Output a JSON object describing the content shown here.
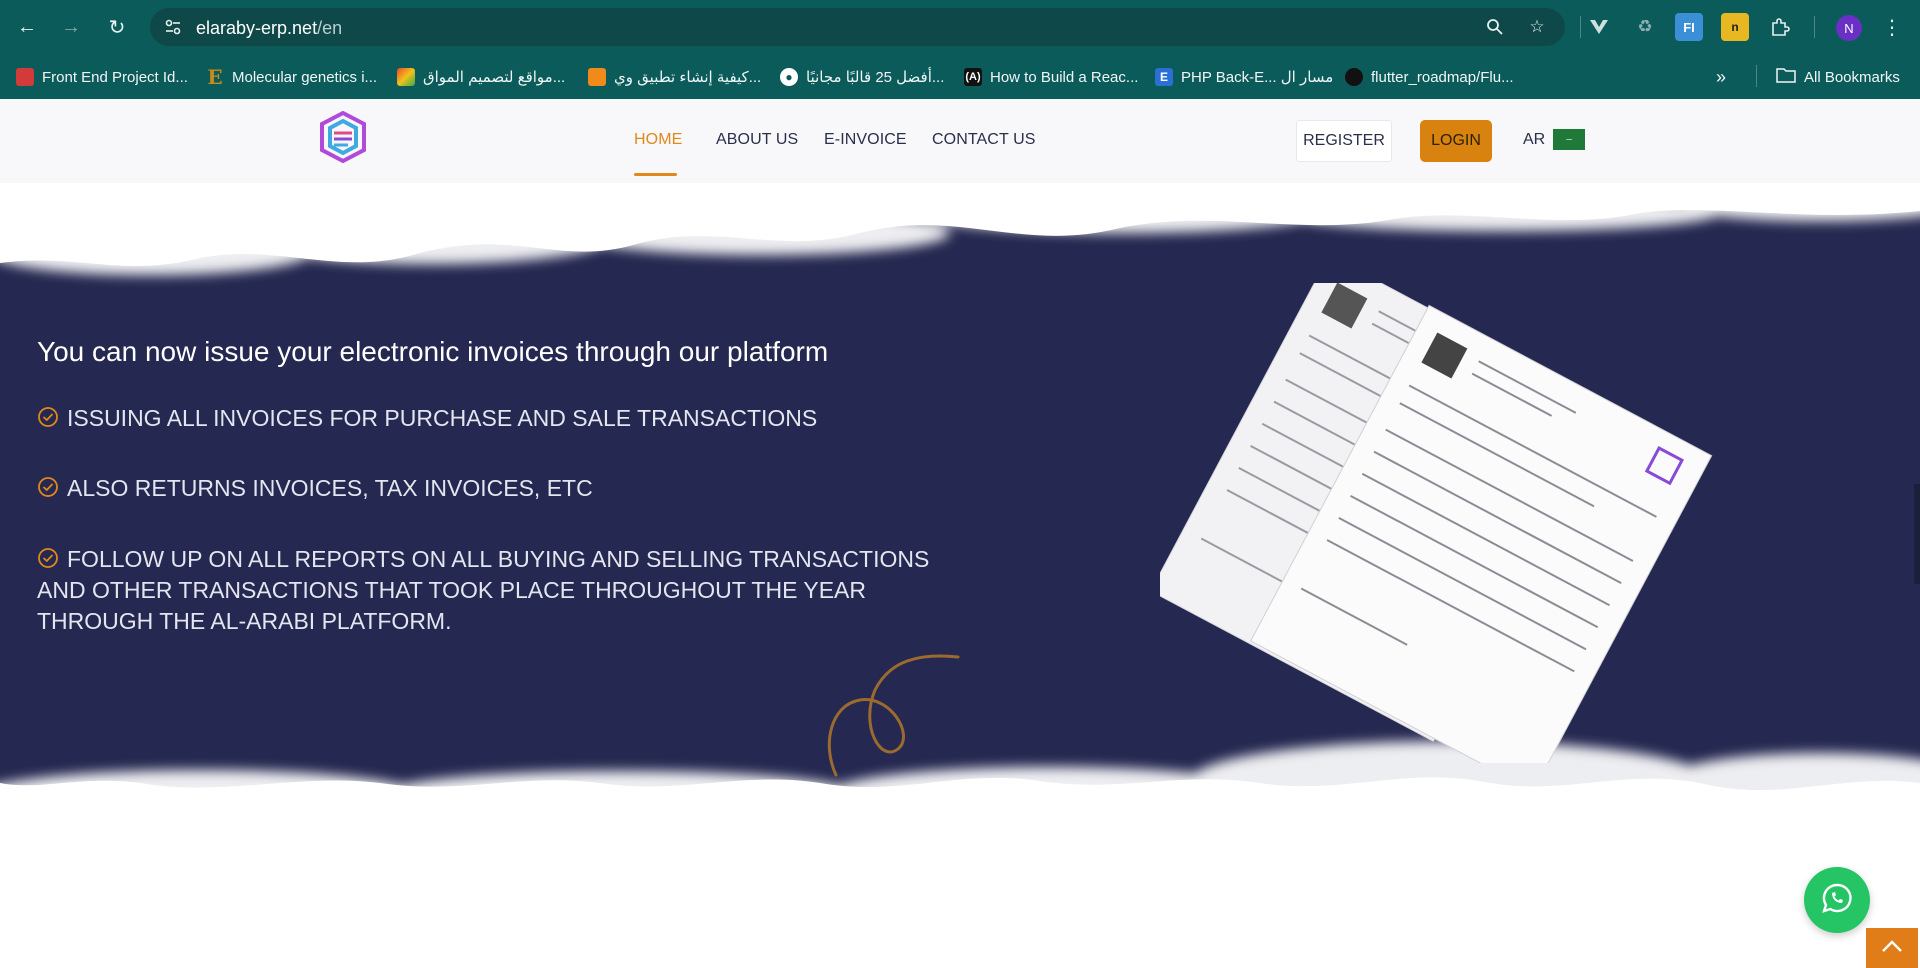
{
  "browser": {
    "url_host": "elaraby-erp.net",
    "url_path": "/en",
    "profile_initial": "N",
    "all_bookmarks_label": "All Bookmarks",
    "bookmarks": [
      {
        "label": "Front End Project Id...",
        "icon": "red-bookmark-icon",
        "color": "#d33a3a"
      },
      {
        "label": "Molecular genetics i...",
        "icon": "letter-e-icon",
        "color": "#c98b1c"
      },
      {
        "label": "مواقع لتصميم المواق...",
        "icon": "colorful-bird-icon",
        "color": "#e2a21a"
      },
      {
        "label": "كيفية إنشاء تطبيق وي...",
        "icon": "orange-cube-icon",
        "color": "#f08a1a"
      },
      {
        "label": "أفضل 25 قالبًا مجانيًا...",
        "icon": "globe-icon",
        "color": "#ffffff"
      },
      {
        "label": "How to Build a Reac...",
        "icon": "react-logo-icon",
        "color": "#111111"
      },
      {
        "label": "PHP Back-E... مسار ال",
        "icon": "letter-e-blue-icon",
        "color": "#2b6fd6"
      },
      {
        "label": "flutter_roadmap/Flu...",
        "icon": "github-icon",
        "color": "#111111"
      }
    ]
  },
  "site": {
    "nav": [
      {
        "label": "HOME",
        "active": true
      },
      {
        "label": "ABOUT US",
        "active": false
      },
      {
        "label": "E-INVOICE",
        "active": false
      },
      {
        "label": "CONTACT US",
        "active": false
      }
    ],
    "register_label": "REGISTER",
    "login_label": "LOGIN",
    "lang_label": "AR"
  },
  "hero": {
    "title": "You can now issue your electronic invoices through our platform",
    "features": [
      "ISSUING ALL INVOICES FOR PURCHASE AND SALE TRANSACTIONS",
      "ALSO RETURNS INVOICES, TAX INVOICES, ETC",
      "FOLLOW UP ON ALL REPORTS ON ALL BUYING AND SELLING TRANSACTIONS AND OTHER TRANSACTIONS THAT TOOK PLACE THROUGHOUT THE YEAR THROUGH THE AL-ARABI PLATFORM."
    ]
  },
  "colors": {
    "chrome": "#0b5b5b",
    "hero_bg": "#252850",
    "accent": "#e0891b",
    "whatsapp": "#25c565"
  }
}
